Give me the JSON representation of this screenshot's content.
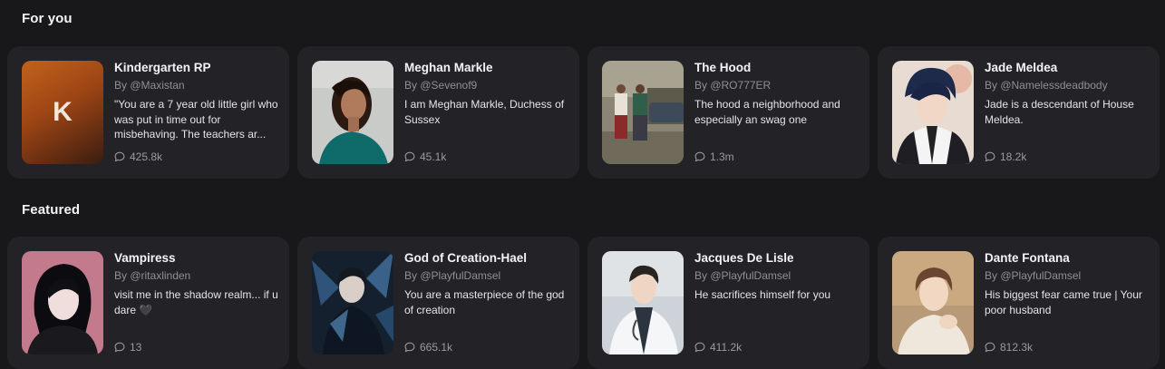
{
  "sections": [
    {
      "title": "For you",
      "cards": [
        {
          "name": "Kindergarten RP",
          "author": "By @Maxistan",
          "description": "\"You are a 7 year old little girl who was put in time out for misbehaving. The teachers ar...",
          "chats": "425.8k",
          "avatar_letter": "K"
        },
        {
          "name": "Meghan Markle",
          "author": "By @Sevenof9",
          "description": "I am Meghan Markle, Duchess of Sussex",
          "chats": "45.1k"
        },
        {
          "name": "The Hood",
          "author": "By @RO777ER",
          "description": "The hood a neighborhood and especially an swag one",
          "chats": "1.3m"
        },
        {
          "name": "Jade Meldea",
          "author": "By @Namelessdeadbody",
          "description": "Jade is a descendant of House Meldea.",
          "chats": "18.2k"
        }
      ]
    },
    {
      "title": "Featured",
      "cards": [
        {
          "name": "Vampiress",
          "author": "By @ritaxlinden",
          "description": "visit me in the shadow realm... if u dare 🖤",
          "chats": "13"
        },
        {
          "name": "God of Creation-Hael",
          "author": "By @PlayfulDamsel",
          "description": "You are a masterpiece of the god of creation",
          "chats": "665.1k"
        },
        {
          "name": "Jacques De Lisle",
          "author": "By @PlayfulDamsel",
          "description": "He sacrifices himself for you",
          "chats": "411.2k"
        },
        {
          "name": "Dante Fontana",
          "author": "By @PlayfulDamsel",
          "description": "His biggest fear came true | Your poor husband",
          "chats": "812.3k"
        }
      ]
    }
  ]
}
